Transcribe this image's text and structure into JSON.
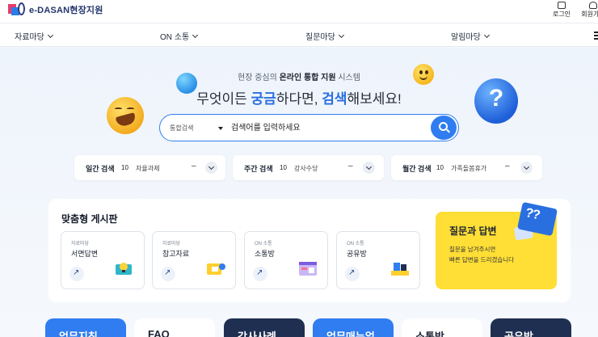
{
  "header": {
    "logo_text": "e-DASAN현장지원",
    "login_label": "로그인",
    "signup_label": "회원가입"
  },
  "nav": {
    "items": [
      {
        "label": "자료마당"
      },
      {
        "label": "ON 소통"
      },
      {
        "label": "질문마당"
      },
      {
        "label": "알림마당"
      }
    ]
  },
  "hero": {
    "sub_prefix": "현장 중심의 ",
    "sub_bold": "온라인 통합 지원",
    "sub_suffix": " 시스템",
    "title_a": "무엇이든 ",
    "title_hl1": "궁금",
    "title_b": "하다면, ",
    "title_hl2": "검색",
    "title_c": "해보세요!"
  },
  "search": {
    "type_label": "통합검색",
    "placeholder": "검색어를 입력하세요",
    "value": ""
  },
  "rankings": [
    {
      "title": "일간 검색",
      "rank": "10",
      "keyword": "자율과제",
      "dash": "–"
    },
    {
      "title": "주간 검색",
      "rank": "10",
      "keyword": "강사수당",
      "dash": "–"
    },
    {
      "title": "월간 검색",
      "rank": "10",
      "keyword": "가족돌봄휴가",
      "dash": "–"
    }
  ],
  "board": {
    "title": "맞춤형 게시판",
    "cards": [
      {
        "category": "자료마당",
        "name": "서면답변"
      },
      {
        "category": "자료마당",
        "name": "참고자료"
      },
      {
        "category": "ON 소통",
        "name": "소통방"
      },
      {
        "category": "ON 소통",
        "name": "공유방"
      }
    ]
  },
  "qa": {
    "title": "질문과 답변",
    "line1": "질문을 남겨주시면",
    "line2": "빠른 답변을 드리겠습니다",
    "icon_text": "??"
  },
  "tiles": [
    {
      "label": "업무지침",
      "bg": "#2f7df0",
      "fg": "#ffffff"
    },
    {
      "label": "FAQ",
      "bg": "#ffffff",
      "fg": "#1b2233"
    },
    {
      "label": "강사사례",
      "bg": "#1f2f52",
      "fg": "#ffffff"
    },
    {
      "label": "업무매뉴얼",
      "bg": "#2f7df0",
      "fg": "#ffffff"
    },
    {
      "label": "소통방",
      "bg": "#ffffff",
      "fg": "#1b2233"
    },
    {
      "label": "공유방",
      "bg": "#1f2f52",
      "fg": "#ffffff"
    }
  ],
  "colors": {
    "accent": "#2f7df0",
    "yellow": "#ffde35",
    "navy": "#1f2f52"
  }
}
